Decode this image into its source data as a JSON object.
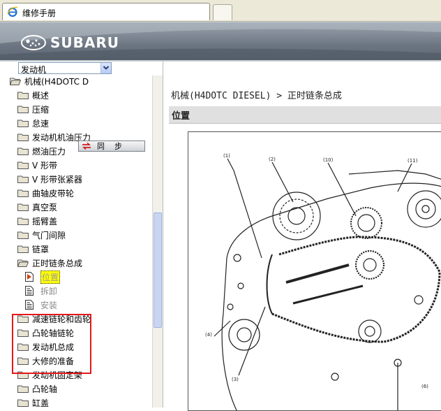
{
  "window": {
    "tab_title": "维修手册"
  },
  "header": {
    "brand": "SUBARU"
  },
  "sidebar": {
    "dropdown_value": "发动机",
    "sync_label": "同步",
    "tree": [
      {
        "label": "机械(H4DOTC D",
        "level": 0,
        "open": true
      },
      {
        "label": "概述",
        "level": 1
      },
      {
        "label": "压缩",
        "level": 1
      },
      {
        "label": "怠速",
        "level": 1
      },
      {
        "label": "发动机机油压力",
        "level": 1
      },
      {
        "label": "燃油压力",
        "level": 1
      },
      {
        "label": "V 形带",
        "level": 1
      },
      {
        "label": "V 形带张紧器",
        "level": 1
      },
      {
        "label": "曲轴皮带轮",
        "level": 1
      },
      {
        "label": "真空泵",
        "level": 1
      },
      {
        "label": "摇臂盖",
        "level": 1
      },
      {
        "label": "气门间隙",
        "level": 1
      },
      {
        "label": "链罩",
        "level": 1
      },
      {
        "label": "正时链条总成",
        "level": 1,
        "open": true
      },
      {
        "label": "位置",
        "level": 2,
        "selected": true
      },
      {
        "label": "拆卸",
        "level": 2
      },
      {
        "label": "安装",
        "level": 2
      },
      {
        "label": "减速链轮和齿轮",
        "level": 1
      },
      {
        "label": "凸轮轴链轮",
        "level": 1
      },
      {
        "label": "发动机总成",
        "level": 1
      },
      {
        "label": "大修的准备",
        "level": 1
      },
      {
        "label": "发动机固定架",
        "level": 1
      },
      {
        "label": "凸轮轴",
        "level": 1
      },
      {
        "label": "缸盖",
        "level": 1
      }
    ]
  },
  "content": {
    "breadcrumb": "机械(H4DOTC DIESEL) > 正时链条总成",
    "section_title": "位置",
    "figure_callouts": [
      "(1)",
      "(2)",
      "(10)",
      "(11)",
      "(4)",
      "(3)",
      "(6)"
    ]
  },
  "colors": {
    "highlight_box": "#e21818",
    "selected_bg": "#ffff00",
    "banner": "#6c7682"
  }
}
